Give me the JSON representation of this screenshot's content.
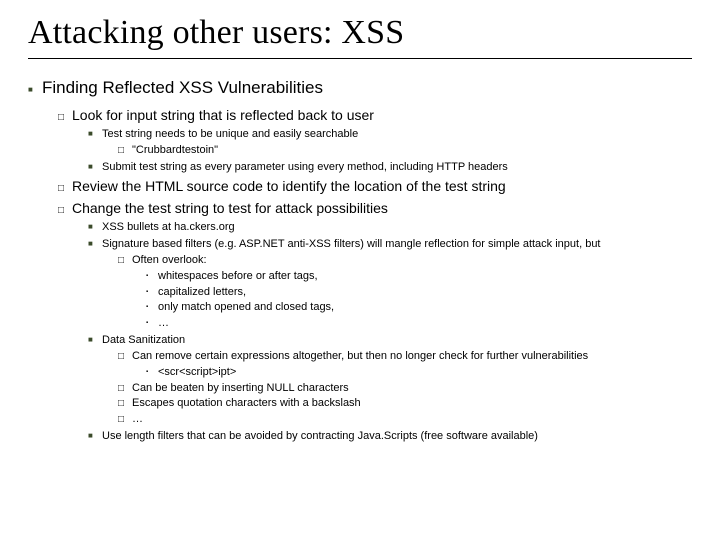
{
  "title": "Attacking other users: XSS",
  "l1": "Finding Reflected XSS Vulnerabilities",
  "l2a": "Look for input string that is reflected back to user",
  "l3a": "Test string needs to be unique and easily searchable",
  "l4a": "\"Crubbardtestoin\"",
  "l3b": "Submit test string as every parameter using every method, including HTTP headers",
  "l2b": "Review the HTML source code to identify the location of the test string",
  "l2c": "Change the test string to test for attack possibilities",
  "l3c": "XSS bullets at ha.ckers.org",
  "l3d": "Signature based filters (e.g. ASP.NET anti-XSS filters) will mangle reflection for simple attack input, but",
  "l4b": "Often overlook:",
  "l5a": "whitespaces before or after tags,",
  "l5b": "capitalized letters,",
  "l5c": "only match opened and closed tags,",
  "l5d": "…",
  "l3e": "Data Sanitization",
  "l4c": "Can remove certain expressions altogether, but then no longer check for further vulnerabilities",
  "l5e": "<scr<script>ipt>",
  "l4d": "Can be beaten by inserting NULL characters",
  "l4e": "Escapes quotation characters with a backslash",
  "l4f": "…",
  "l3f": "Use length filters that can be avoided by contracting Java.Scripts (free software available)"
}
